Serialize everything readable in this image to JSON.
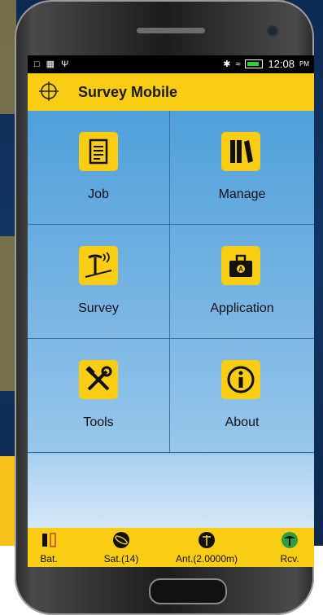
{
  "status_bar": {
    "time": "12:08",
    "ampm": "PM"
  },
  "app": {
    "title": "Survey Mobile"
  },
  "menu": {
    "items": [
      {
        "label": "Job",
        "icon": "document-icon"
      },
      {
        "label": "Manage",
        "icon": "books-icon"
      },
      {
        "label": "Survey",
        "icon": "survey-pole-icon"
      },
      {
        "label": "Application",
        "icon": "toolbox-icon"
      },
      {
        "label": "Tools",
        "icon": "wrench-hammer-icon"
      },
      {
        "label": "About",
        "icon": "info-icon"
      }
    ]
  },
  "bottom_bar": {
    "battery": "Bat.",
    "satellites": "Sat.(14)",
    "antenna": "Ant.(2.0000m)",
    "receiver": "Rcv."
  },
  "colors": {
    "accent": "#f9cd13",
    "tile_blue": "#4fa0db",
    "receiver_green": "#2e9e3e"
  }
}
